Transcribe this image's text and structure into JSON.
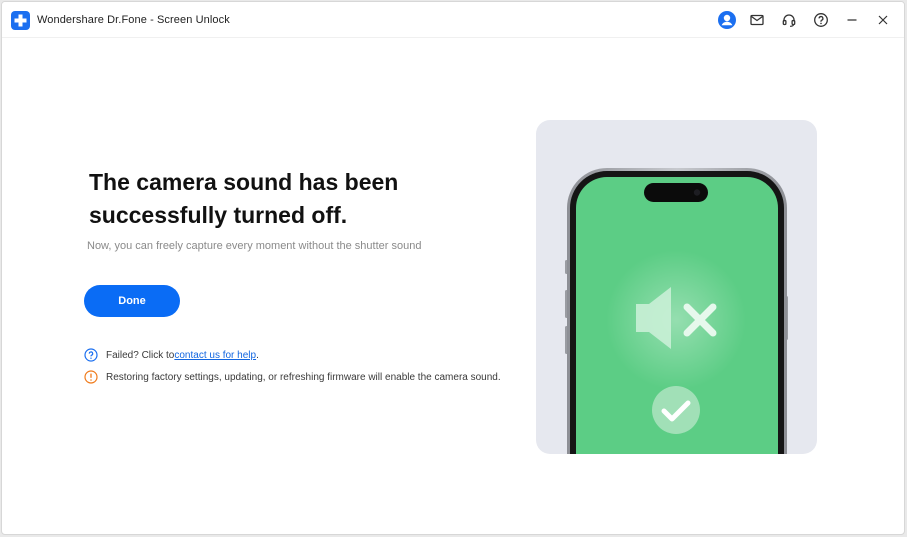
{
  "window": {
    "title": "Wondershare Dr.Fone - Screen Unlock",
    "accent_color": "#0a6cf5",
    "icons": [
      "drfone-logo-icon",
      "account-icon",
      "mail-icon",
      "support-headset-icon",
      "help-icon",
      "minimize-icon",
      "close-icon"
    ]
  },
  "main": {
    "headline": "The camera sound has been successfully turned off.",
    "subtitle": "Now, you can freely capture every moment without the shutter sound",
    "done_label": "Done",
    "help_prefix": "Failed? Click to ",
    "help_link": "contact us for help",
    "help_suffix": ".",
    "warning": "Restoring factory settings, updating, or refreshing firmware will enable the camera sound.",
    "status_colors": {
      "help": "#1b6ff0",
      "warning": "#f07a1a",
      "screen": "#5ccd85"
    }
  }
}
